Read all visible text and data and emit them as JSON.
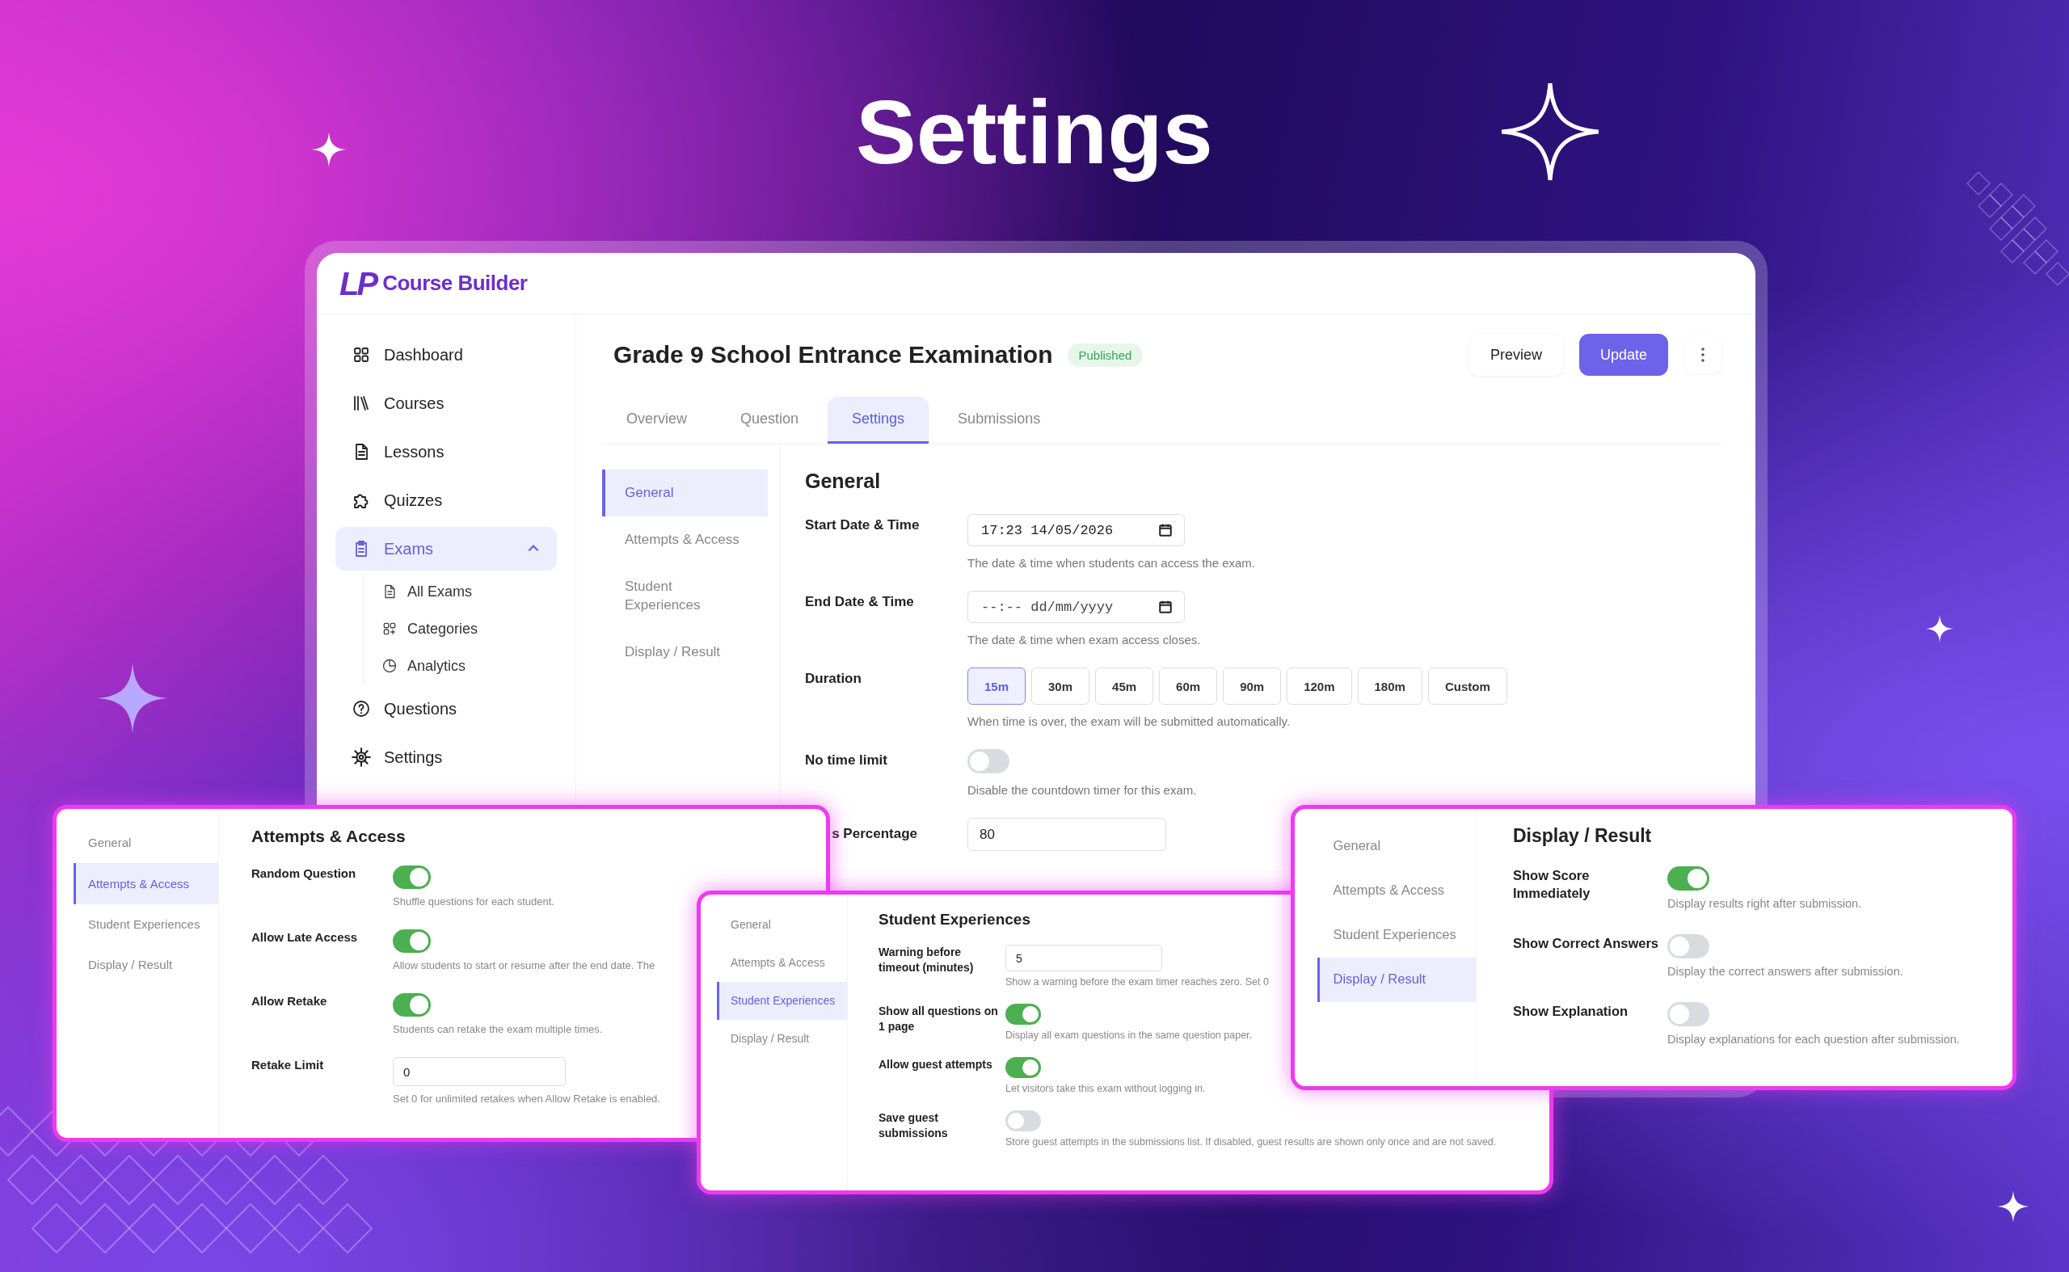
{
  "headline": "Settings",
  "app": {
    "logo_mark": "LP",
    "brand": "Course Builder",
    "sidebar": [
      {
        "label": "Dashboard",
        "selected": false
      },
      {
        "label": "Courses",
        "selected": false
      },
      {
        "label": "Lessons",
        "selected": false
      },
      {
        "label": "Quizzes",
        "selected": false
      },
      {
        "label": "Exams",
        "selected": true,
        "expanded": true,
        "children": [
          {
            "label": "All Exams",
            "selected": false
          },
          {
            "label": "Categories",
            "selected": false
          },
          {
            "label": "Analytics",
            "selected": false
          }
        ]
      },
      {
        "label": "Questions",
        "selected": false
      },
      {
        "label": "Settings",
        "selected": false
      }
    ],
    "page_title": "Grade 9 School Entrance Examination",
    "status": "Published",
    "actions": [
      {
        "label": "Preview",
        "kind": "secondary"
      },
      {
        "label": "Update",
        "kind": "primary"
      }
    ],
    "tabs": [
      {
        "label": "Overview",
        "selected": false
      },
      {
        "label": "Question",
        "selected": false
      },
      {
        "label": "Settings",
        "selected": true
      },
      {
        "label": "Submissions",
        "selected": false
      }
    ],
    "settings_nav": [
      {
        "label": "General",
        "selected": true
      },
      {
        "label": "Attempts & Access",
        "selected": false
      },
      {
        "label": "Student Experiences",
        "selected": false
      },
      {
        "label": "Display / Result",
        "selected": false
      }
    ],
    "section": {
      "heading": "General",
      "fields": [
        {
          "kind": "datetime",
          "label": "Start Date & Time",
          "value": "17:23 14/05/2026",
          "help": "The date & time when students can access the exam."
        },
        {
          "kind": "datetime",
          "label": "End Date & Time",
          "placeholder": "--:-- dd/mm/yyyy",
          "help": "The date & time when exam access closes."
        },
        {
          "kind": "duration",
          "label": "Duration",
          "options": [
            {
              "label": "15m",
              "selected": true
            },
            {
              "label": "30m",
              "selected": false
            },
            {
              "label": "45m",
              "selected": false
            },
            {
              "label": "60m",
              "selected": false
            },
            {
              "label": "90m",
              "selected": false
            },
            {
              "label": "120m",
              "selected": false
            },
            {
              "label": "180m",
              "selected": false
            },
            {
              "label": "Custom",
              "selected": false
            }
          ],
          "help": "When time is over, the exam will be submitted automatically."
        },
        {
          "kind": "toggle",
          "label": "No time limit",
          "on": false,
          "help": "Disable the countdown timer for this exam."
        },
        {
          "kind": "number",
          "label": "s Percentage",
          "value": "80"
        }
      ]
    }
  },
  "panels": [
    {
      "nav": [
        {
          "label": "General",
          "selected": false
        },
        {
          "label": "Attempts & Access",
          "selected": true
        },
        {
          "label": "Student Experiences",
          "selected": false
        },
        {
          "label": "Display / Result",
          "selected": false
        }
      ],
      "heading": "Attempts & Access",
      "rows": [
        {
          "kind": "toggle",
          "label": "Random Question",
          "on": true,
          "help": "Shuffle questions for each student."
        },
        {
          "kind": "toggle",
          "label": "Allow Late Access",
          "on": true,
          "help": "Allow students to start or resume after the end date. The"
        },
        {
          "kind": "toggle",
          "label": "Allow Retake",
          "on": true,
          "help": "Students can retake the exam multiple times."
        },
        {
          "kind": "number",
          "label": "Retake Limit",
          "value": "0",
          "help": "Set 0 for unlimited retakes when Allow Retake is enabled."
        }
      ]
    },
    {
      "nav": [
        {
          "label": "General",
          "selected": false
        },
        {
          "label": "Attempts & Access",
          "selected": false
        },
        {
          "label": "Student Experiences",
          "selected": true
        },
        {
          "label": "Display / Result",
          "selected": false
        }
      ],
      "heading": "Student Experiences",
      "rows": [
        {
          "kind": "number",
          "label": "Warning before timeout (minutes)",
          "value": "5",
          "help": "Show a warning before the exam timer reaches zero. Set 0"
        },
        {
          "kind": "toggle",
          "label": "Show all questions on 1 page",
          "on": true,
          "help": "Display all exam questions in the same question paper."
        },
        {
          "kind": "toggle",
          "label": "Allow guest attempts",
          "on": true,
          "help": "Let visitors take this exam without logging in."
        },
        {
          "kind": "toggle",
          "label": "Save guest submissions",
          "on": false,
          "help": "Store guest attempts in the submissions list. If disabled, guest results are shown only once and are not saved."
        }
      ]
    },
    {
      "nav": [
        {
          "label": "General",
          "selected": false
        },
        {
          "label": "Attempts & Access",
          "selected": false
        },
        {
          "label": "Student Experiences",
          "selected": false
        },
        {
          "label": "Display / Result",
          "selected": true
        }
      ],
      "heading": "Display / Result",
      "rows": [
        {
          "kind": "toggle",
          "label": "Show Score Immediately",
          "on": true,
          "help": "Display results right after submission."
        },
        {
          "kind": "toggle",
          "label": "Show Correct Answers",
          "on": false,
          "help": "Display the correct answers after submission."
        },
        {
          "kind": "toggle",
          "label": "Show Explanation",
          "on": false,
          "help": "Display explanations for each question after submission."
        }
      ]
    }
  ]
}
